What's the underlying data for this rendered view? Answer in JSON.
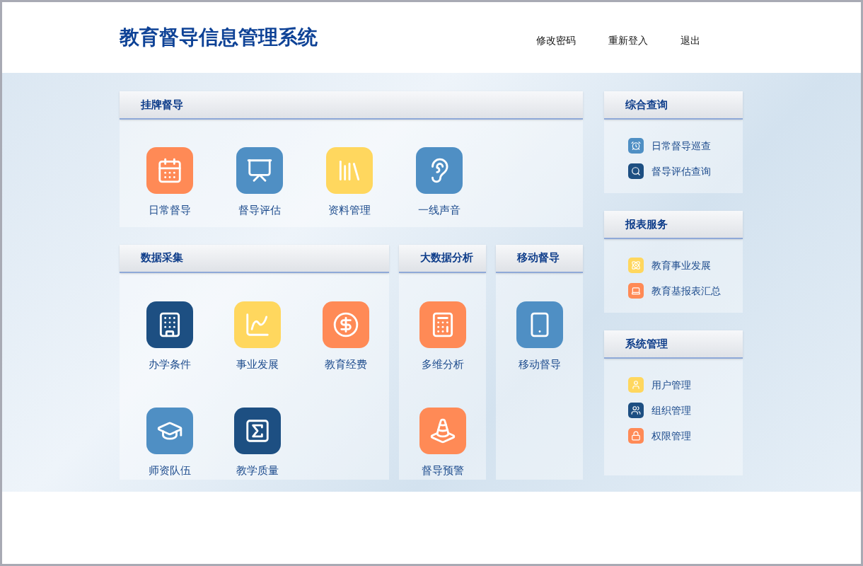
{
  "header": {
    "title": "教育督导信息管理系统",
    "nav": [
      "修改密码",
      "重新登入",
      "退出"
    ]
  },
  "top_panel": {
    "title": "挂牌督导",
    "items": [
      {
        "label": "日常督导",
        "color": "#ff8a56"
      },
      {
        "label": "督导评估",
        "color": "#4f8fc4"
      },
      {
        "label": "资料管理",
        "color": "#ffd75e"
      },
      {
        "label": "一线声音",
        "color": "#4f8fc4"
      }
    ]
  },
  "bottom_panels": [
    {
      "title": "数据采集",
      "items": [
        {
          "label": "办学条件",
          "color": "#1d4f82"
        },
        {
          "label": "事业发展",
          "color": "#ffd75e"
        },
        {
          "label": "教育经费",
          "color": "#ff8a56"
        },
        {
          "label": "师资队伍",
          "color": "#4f8fc4"
        },
        {
          "label": "教学质量",
          "color": "#1d4f82"
        }
      ]
    },
    {
      "title": "大数据分析",
      "items": [
        {
          "label": "多维分析",
          "color": "#ff8a56"
        },
        {
          "label": "督导预警",
          "color": "#ff8a56"
        }
      ]
    },
    {
      "title": "移动督导",
      "items": [
        {
          "label": "移动督导",
          "color": "#4f8fc4"
        }
      ]
    }
  ],
  "sidebar": [
    {
      "title": "综合查询",
      "items": [
        {
          "label": "日常督导巡查",
          "color": "#4f8fc4"
        },
        {
          "label": "督导评估查询",
          "color": "#1d4f82"
        }
      ]
    },
    {
      "title": "报表服务",
      "items": [
        {
          "label": "教育事业发展",
          "color": "#ffd75e"
        },
        {
          "label": "教育基报表汇总",
          "color": "#ff8a56"
        }
      ]
    },
    {
      "title": "系统管理",
      "items": [
        {
          "label": "用户管理",
          "color": "#ffd75e"
        },
        {
          "label": "组织管理",
          "color": "#1d4f82"
        },
        {
          "label": "权限管理",
          "color": "#ff8a56"
        }
      ]
    }
  ]
}
